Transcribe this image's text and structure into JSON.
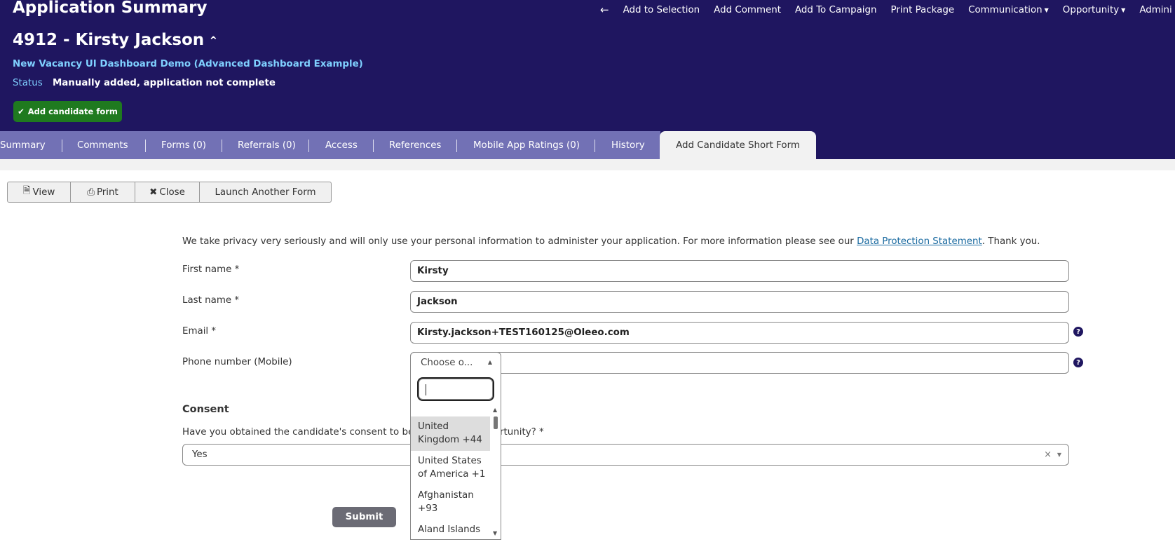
{
  "header": {
    "title": "Application Summary",
    "nav": {
      "back_icon": "arrow-left-icon",
      "items": [
        "Add to Selection",
        "Add Comment",
        "Add To Campaign",
        "Print Package",
        "Communication",
        "Opportunity",
        "Admini"
      ]
    },
    "candidate": "4912 - Kirsty Jackson",
    "vacancy": "New Vacancy UI Dashboard Demo (Advanced Dashboard Example)",
    "status_label": "Status",
    "status_value": "Manually added, application not complete",
    "add_form_button": "Add candidate form"
  },
  "tabs": {
    "items": [
      "Summary",
      "Comments",
      "Forms (0)",
      "Referrals (0)",
      "Access",
      "References",
      "Mobile App Ratings (0)",
      "History"
    ],
    "active": "Add Candidate Short Form"
  },
  "toolbar": {
    "view": "View",
    "print": "Print",
    "close": "Close",
    "launch": "Launch Another Form"
  },
  "form": {
    "privacy_text": "We take privacy very seriously and will only use your personal information to administer your application. For more information please see our ",
    "privacy_link": "Data Protection Statement",
    "privacy_end": ". Thank you.",
    "first_name_label": "First name *",
    "first_name_value": "Kirsty",
    "last_name_label": "Last name *",
    "last_name_value": "Jackson",
    "email_label": "Email *",
    "email_value": "Kirsty.jackson+TEST160125@Oleeo.com",
    "phone_label": "Phone number (Mobile)",
    "phone_select": "Choose o...",
    "phone_options": [
      "United Kingdom +44",
      "United States of America +1",
      "Afghanistan +93",
      "Aland Islands"
    ],
    "consent_title": "Consent",
    "consent_question_start": "Have you obtained the candidate's consent to be",
    "consent_question_end": "rtunity? *",
    "consent_value": "Yes",
    "submit": "Submit"
  },
  "colors": {
    "header_bg": "#1f1660",
    "tab_bar": "#7271b5",
    "accent_link": "#7fd0ff",
    "add_button": "#1f7a1f"
  }
}
